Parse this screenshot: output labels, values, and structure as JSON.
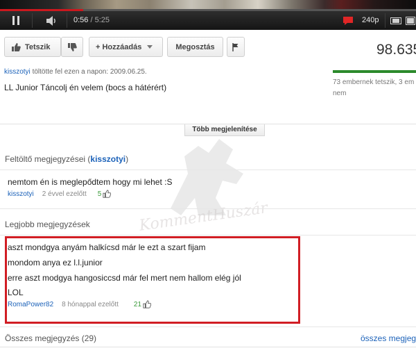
{
  "player": {
    "progress": 0.2,
    "time_current": "0:56",
    "time_separator": "/",
    "time_total": "5:25",
    "quality": "240p"
  },
  "actions": {
    "like_label": "Tetszik",
    "add_label": "+ Hozzáadás",
    "share_label": "Megosztás",
    "view_count": "98.635"
  },
  "upload": {
    "uploader": "kisszotyi",
    "uploaded_text": "töltötte fel ezen a napon: 2009.06.25.",
    "title": "LL Junior Táncolj én velem (bocs a hátérért)"
  },
  "likes": {
    "line1": "73 embernek tetszik, 3 em",
    "line2": "nem"
  },
  "more_button": "Több megjelenítése",
  "uploader_comments": {
    "title_prefix": "Feltöltő megjegyzései (",
    "title_user": "kisszotyi",
    "title_suffix": ")",
    "comment": {
      "text": "nemtom én is meglepődtem hogy mi lehet :S",
      "author": "kisszotyi",
      "time": "2 évvel ezelőtt",
      "likes": "5"
    }
  },
  "top_comments": {
    "title": "Legjobb megjegyzések",
    "comment": {
      "lines": [
        "aszt mondgya anyám halkícsd már le ezt a szart fijam",
        "mondom anya ez l.l.junior",
        "erre aszt modgya hangosiccsd már fel mert nem hallom elég jól",
        "LOL"
      ],
      "author": "RomaPower82",
      "time": "8 hónappal ezelőtt",
      "likes": "21"
    }
  },
  "watermark": "KommentHuszár",
  "all_comments": {
    "title": "Összes megjegyzés (29)",
    "link": "összes megjegyzés"
  },
  "colors": {
    "accent_red": "#cc181e",
    "highlight_box": "#d11d24",
    "link_blue": "#1c62b9",
    "like_green": "#2c8a2c"
  }
}
